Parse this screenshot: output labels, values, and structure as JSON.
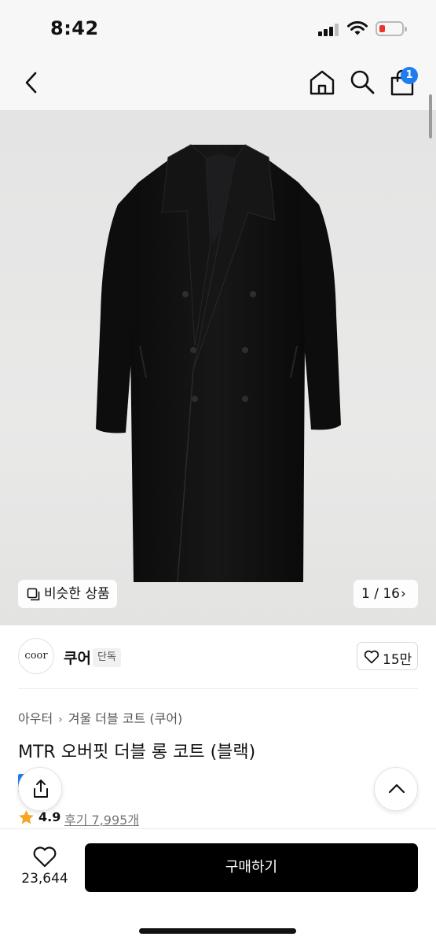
{
  "status_bar": {
    "time": "8:42",
    "battery_color": "#e8352f"
  },
  "nav": {
    "back_icon": "chevron-left-icon",
    "home_icon": "home-icon",
    "search_icon": "search-icon",
    "cart_icon": "shopping-bag-icon",
    "cart_badge": "1",
    "badge_color": "#1e7ef0"
  },
  "gallery": {
    "similar_products_label": "비슷한 상품",
    "similar_icon": "copy-icon",
    "page_counter": "1 / 16",
    "counter_chevron": "›"
  },
  "brand": {
    "logo_text": "coor",
    "name": "쿠어",
    "tag": "단독",
    "like_count": "15만"
  },
  "product": {
    "breadcrumb": [
      "아우터",
      "겨울 더블 코트 (쿠어)"
    ],
    "breadcrumb_separator": "›",
    "title": "MTR 오버핏 더블 롱 코트 (블랙)",
    "rating": "4.9",
    "reviews_label": "후기 7,995개"
  },
  "bottom_bar": {
    "like_count": "23,644",
    "buy_label": "구매하기"
  }
}
